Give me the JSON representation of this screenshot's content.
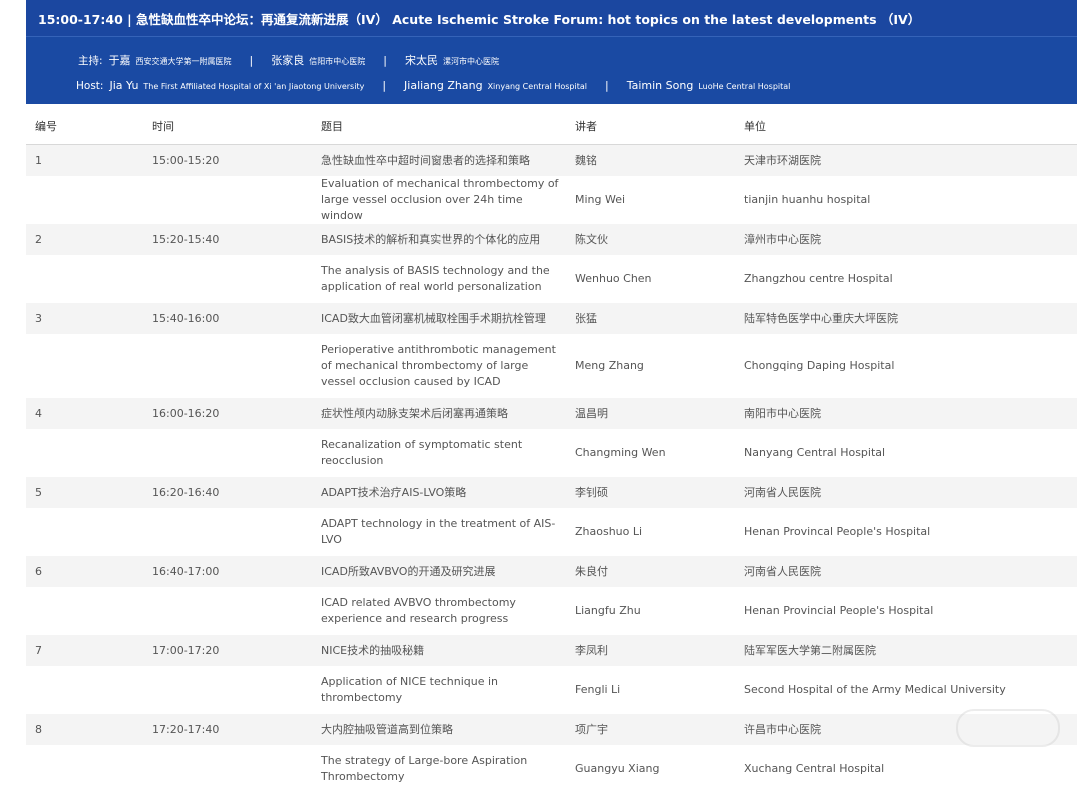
{
  "header": {
    "title": "15:00-17:40 | 急性缺血性卒中论坛：再通复流新进展（IV）  Acute Ischemic Stroke Forum: hot topics on the latest developments （IV）",
    "host_cn_label": "主持:",
    "host_en_label": "Host:",
    "hosts_cn": [
      {
        "name": "于嘉",
        "inst": "西安交通大学第一附属医院"
      },
      {
        "name": "张家良",
        "inst": "信阳市中心医院"
      },
      {
        "name": "宋太民",
        "inst": "漯河市中心医院"
      }
    ],
    "hosts_en": [
      {
        "name": "Jia Yu",
        "inst": "The First Affiliated Hospital of Xi 'an Jiaotong University"
      },
      {
        "name": "Jialiang Zhang",
        "inst": "Xinyang Central Hospital"
      },
      {
        "name": "Taimin Song",
        "inst": "LuoHe Central Hospital"
      }
    ],
    "separator": "|"
  },
  "table": {
    "columns": [
      "编号",
      "时间",
      "题目",
      "讲者",
      "单位"
    ],
    "rows": [
      {
        "no": "1",
        "time": "15:00-15:20",
        "topic_cn": "急性缺血性卒中超时间窗患者的选择和策略",
        "speaker_cn": "魏铭",
        "unit_cn": "天津市环湖医院",
        "topic_en": "Evaluation of mechanical thrombectomy of large vessel occlusion over 24h time window",
        "speaker_en": "Ming Wei",
        "unit_en": "tianjin huanhu hospital",
        "lines": 2
      },
      {
        "no": "2",
        "time": "15:20-15:40",
        "topic_cn": "BASIS技术的解析和真实世界的个体化的应用",
        "speaker_cn": "陈文伙",
        "unit_cn": "漳州市中心医院",
        "topic_en": "The analysis of BASIS technology and the application of real world personalization",
        "speaker_en": "Wenhuo Chen",
        "unit_en": "Zhangzhou centre Hospital",
        "lines": 2
      },
      {
        "no": "3",
        "time": "15:40-16:00",
        "topic_cn": "ICAD致大血管闭塞机械取栓围手术期抗栓管理",
        "speaker_cn": "张猛",
        "unit_cn": "陆军特色医学中心重庆大坪医院",
        "topic_en": "Perioperative antithrombotic management of mechanical thrombectomy of large vessel occlusion caused by ICAD",
        "speaker_en": "Meng Zhang",
        "unit_en": "Chongqing Daping Hospital",
        "lines": 3
      },
      {
        "no": "4",
        "time": "16:00-16:20",
        "topic_cn": "症状性颅内动脉支架术后闭塞再通策略",
        "speaker_cn": "温昌明",
        "unit_cn": "南阳市中心医院",
        "topic_en": "Recanalization of symptomatic stent reocclusion",
        "speaker_en": "Changming Wen",
        "unit_en": "Nanyang Central Hospital",
        "lines": 2
      },
      {
        "no": "5",
        "time": "16:20-16:40",
        "topic_cn": "ADAPT技术治疗AIS-LVO策略",
        "speaker_cn": "李钊硕",
        "unit_cn": "河南省人民医院",
        "topic_en": "ADAPT technology in the treatment of AIS-LVO",
        "speaker_en": "Zhaoshuo Li",
        "unit_en": "Henan Provincal People's Hospital",
        "lines": 2
      },
      {
        "no": "6",
        "time": "16:40-17:00",
        "topic_cn": "ICAD所致AVBVO的开通及研究进展",
        "speaker_cn": "朱良付",
        "unit_cn": "河南省人民医院",
        "topic_en": "ICAD related AVBVO thrombectomy experience and research progress",
        "speaker_en": "Liangfu Zhu",
        "unit_en": "Henan Provincial People's Hospital",
        "lines": 2
      },
      {
        "no": "7",
        "time": "17:00-17:20",
        "topic_cn": "NICE技术的抽吸秘籍",
        "speaker_cn": "李凤利",
        "unit_cn": "陆军军医大学第二附属医院",
        "topic_en": "Application of NICE technique in thrombectomy",
        "speaker_en": "Fengli Li",
        "unit_en": "Second Hospital of the Army Medical University",
        "lines": 2
      },
      {
        "no": "8",
        "time": "17:20-17:40",
        "topic_cn": "大内腔抽吸管道高到位策略",
        "speaker_cn": "项广宇",
        "unit_cn": "许昌市中心医院",
        "topic_en": "The strategy of Large-bore Aspiration Thrombectomy",
        "speaker_en": "Guangyu Xiang",
        "unit_en": "Xuchang Central Hospital",
        "lines": 2
      }
    ]
  },
  "colors": {
    "header_bg": "#1a4aa3",
    "row_alt_bg": "#f4f4f4",
    "text": "#555555"
  }
}
